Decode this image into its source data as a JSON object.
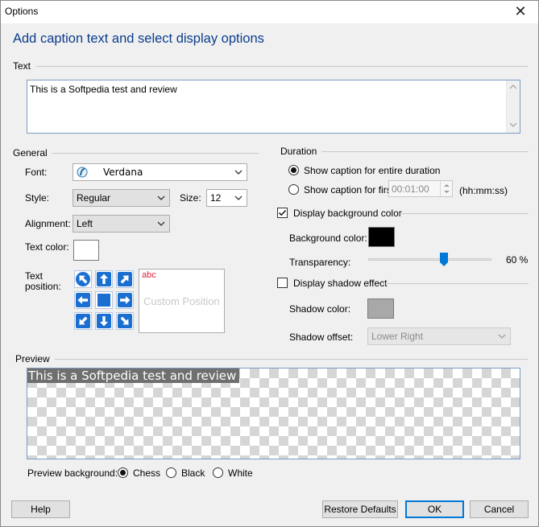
{
  "window": {
    "title": "Options",
    "close_symbol": "✕"
  },
  "header": "Add caption text and select display options",
  "text_section": {
    "label": "Text",
    "value": "This is a Softpedia test and review"
  },
  "general": {
    "label": "General",
    "font_label": "Font:",
    "font_value": "Verdana",
    "style_label": "Style:",
    "style_value": "Regular",
    "size_label": "Size:",
    "size_value": "12",
    "alignment_label": "Alignment:",
    "alignment_value": "Left",
    "text_color_label": "Text color:",
    "text_color": "#ffffff",
    "text_position_label_1": "Text",
    "text_position_label_2": "position:",
    "position_buttons": [
      "arrow-up-left",
      "arrow-up",
      "arrow-up-right",
      "arrow-left",
      "center",
      "arrow-right",
      "arrow-down-left",
      "arrow-down",
      "arrow-down-right"
    ],
    "custom_abc": "abc",
    "custom_position_label": "Custom Position"
  },
  "duration": {
    "label": "Duration",
    "option_entire": "Show caption for entire duration",
    "option_first": "Show caption for first",
    "selected": "entire",
    "time_value": "00:01:00",
    "time_format": "(hh:mm:ss)"
  },
  "background": {
    "checkbox_label": "Display background color",
    "checked": true,
    "color_label": "Background color:",
    "color": "#000000",
    "transparency_label": "Transparency:",
    "transparency_value": "60 %",
    "transparency_percent": 60
  },
  "shadow": {
    "checkbox_label": "Display shadow effect",
    "checked": false,
    "color_label": "Shadow color:",
    "color": "#a8a8a8",
    "offset_label": "Shadow offset:",
    "offset_value": "Lower Right"
  },
  "preview": {
    "label": "Preview",
    "caption": "This is a Softpedia test and review",
    "bg_label": "Preview background:",
    "options": [
      "Chess",
      "Black",
      "White"
    ],
    "selected": "Chess"
  },
  "buttons": {
    "help": "Help",
    "restore": "Restore Defaults",
    "ok": "OK",
    "cancel": "Cancel"
  }
}
